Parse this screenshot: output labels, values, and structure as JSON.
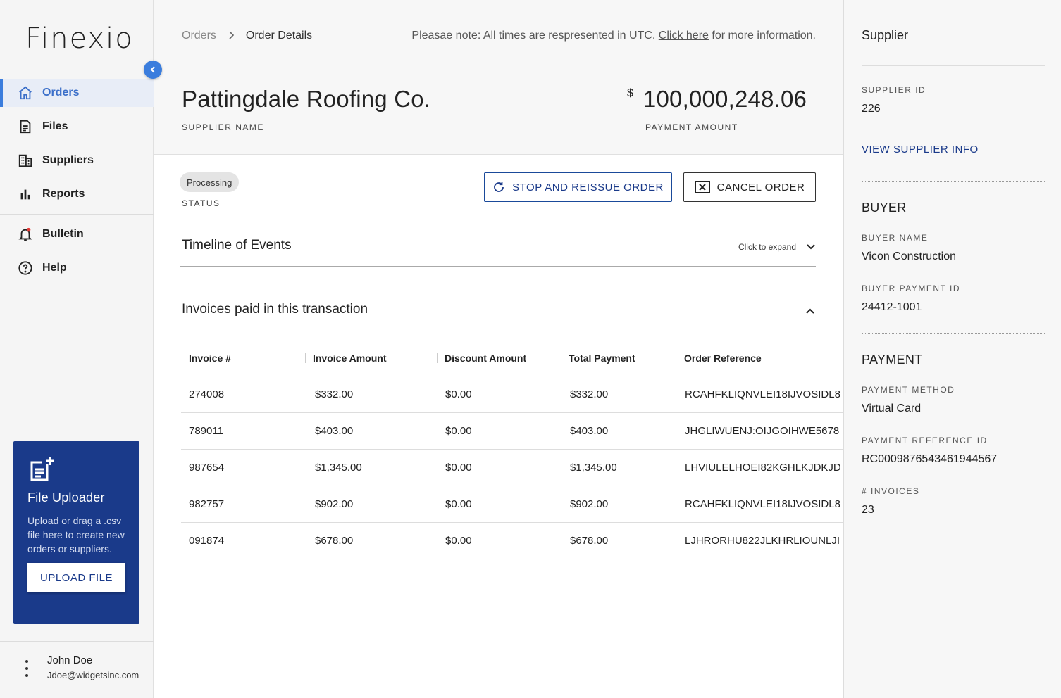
{
  "app": {
    "logo": "Finexio"
  },
  "sidebar": {
    "items": [
      {
        "label": "Orders",
        "icon": "home-icon"
      },
      {
        "label": "Files",
        "icon": "file-icon"
      },
      {
        "label": "Suppliers",
        "icon": "building-icon"
      },
      {
        "label": "Reports",
        "icon": "bar-chart-icon"
      },
      {
        "label": "Bulletin",
        "icon": "bell-icon"
      },
      {
        "label": "Help",
        "icon": "help-icon"
      }
    ],
    "uploader": {
      "title": "File Uploader",
      "description": "Upload or drag a .csv file here to create new orders or suppliers.",
      "button": "UPLOAD FILE"
    },
    "user": {
      "name": "John Doe",
      "email": "Jdoe@widgetsinc.com"
    }
  },
  "header": {
    "breadcrumb": [
      "Orders",
      "Order Details"
    ],
    "note_prefix": "Pleasae note: All times are respresented in UTC. ",
    "note_link": "Click here",
    "note_suffix": " for more information.",
    "supplier_name": "Pattingdale Roofing Co.",
    "supplier_name_label": "SUPPLIER NAME",
    "currency": "$",
    "payment_amount": "100,000,248.06",
    "payment_amount_label": "PAYMENT AMOUNT"
  },
  "order": {
    "status": "Processing",
    "status_label": "STATUS",
    "reissue_button": "STOP AND REISSUE ORDER",
    "cancel_button": "CANCEL ORDER"
  },
  "timeline": {
    "title": "Timeline of Events",
    "expand_label": "Click to expand"
  },
  "invoices": {
    "title": "Invoices paid in this transaction",
    "columns": [
      "Invoice #",
      "Invoice Amount",
      "Discount Amount",
      "Total Payment",
      "Order Reference"
    ],
    "rows": [
      [
        "274008",
        "$332.00",
        "$0.00",
        "$332.00",
        "RCAHFKLIQNVLEI18IJVOSIDL8"
      ],
      [
        "789011",
        "$403.00",
        "$0.00",
        "$403.00",
        "JHGLIWUENJ:OIJGOIHWE5678"
      ],
      [
        "987654",
        "$1,345.00",
        "$0.00",
        "$1,345.00",
        "LHVIULELHOEI82KGHLKJDKJD"
      ],
      [
        "982757",
        "$902.00",
        "$0.00",
        "$902.00",
        "RCAHFKLIQNVLEI18IJVOSIDL8"
      ],
      [
        "091874",
        "$678.00",
        "$0.00",
        "$678.00",
        "LJHRORHU822JLKHRLIOUNLJI"
      ]
    ]
  },
  "details": {
    "supplier_heading": "Supplier",
    "supplier_id_label": "SUPPLIER ID",
    "supplier_id": "226",
    "view_supplier_link": "VIEW SUPPLIER INFO",
    "buyer_heading": "BUYER",
    "buyer_name_label": "BUYER NAME",
    "buyer_name": "Vicon Construction",
    "buyer_payment_id_label": "BUYER PAYMENT ID",
    "buyer_payment_id": "24412-1001",
    "payment_heading": "PAYMENT",
    "payment_method_label": "PAYMENT METHOD",
    "payment_method": "Virtual Card",
    "payment_reference_label": "PAYMENT REFERENCE ID",
    "payment_reference": "RC0009876543461944567",
    "invoice_count_label": "# INVOICES",
    "invoice_count": "23"
  },
  "colors": {
    "accent": "#3b7ddd",
    "primary_dark": "#1a3a8a"
  }
}
